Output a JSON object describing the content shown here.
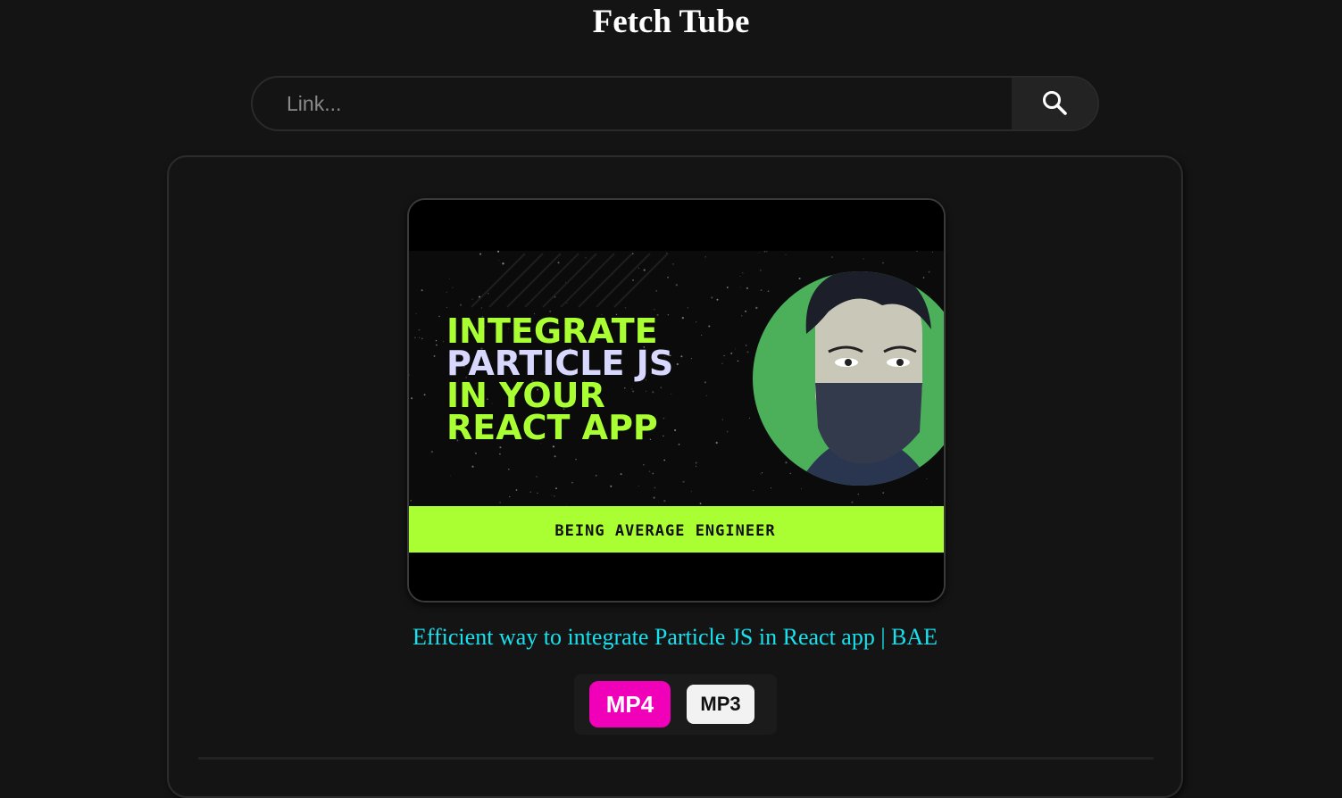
{
  "app": {
    "title": "Fetch Tube"
  },
  "search": {
    "placeholder": "Link...",
    "value": "",
    "button_icon": "search-icon"
  },
  "video": {
    "thumbnail": {
      "headline_lines": [
        "INTEGRATE",
        "PARTICLE JS",
        "IN YOUR",
        "REACT APP"
      ],
      "banner": "BEING AVERAGE ENGINEER",
      "accent_color": "#aaff33",
      "avatar_bg": "#4caf5a"
    },
    "title": "Efficient way to integrate Particle JS in React app | BAE"
  },
  "formats": {
    "options": [
      {
        "label": "MP4",
        "selected": true
      },
      {
        "label": "MP3",
        "selected": false
      }
    ],
    "selected_color": "#f000b8"
  },
  "colors": {
    "background": "#141414",
    "title_link": "#18e0ee"
  }
}
